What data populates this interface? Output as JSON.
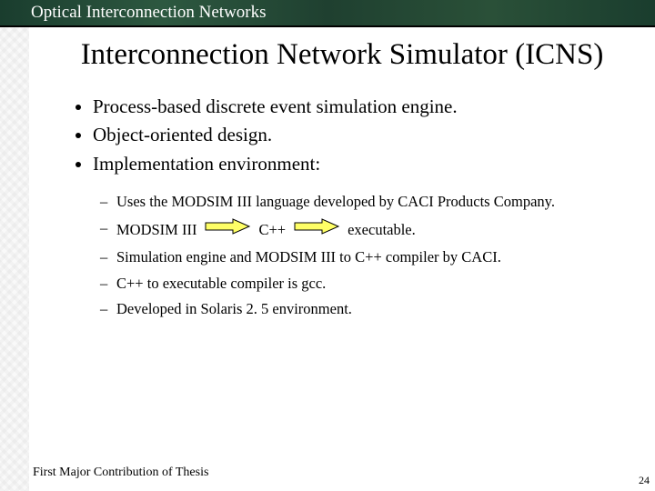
{
  "header": {
    "title": "Optical Interconnection Networks"
  },
  "slide": {
    "title": "Interconnection Network Simulator (ICNS)",
    "bullets": {
      "b1": "Process-based discrete event simulation engine.",
      "b2": "Object-oriented design.",
      "b3": "Implementation environment:"
    },
    "sub": {
      "s1": "Uses the MODSIM III language developed by CACI Products Company.",
      "s2_a": "MODSIM III",
      "s2_b": "C++",
      "s2_c": "executable.",
      "s3": "Simulation engine and MODSIM III to C++ compiler by CACI.",
      "s4": "C++ to executable compiler is gcc.",
      "s5": "Developed in Solaris 2. 5 environment."
    }
  },
  "footer": {
    "text": "First Major Contribution of Thesis"
  },
  "page": {
    "number": "24"
  },
  "colors": {
    "arrow_fill": "#ffff66",
    "arrow_stroke": "#000000"
  }
}
